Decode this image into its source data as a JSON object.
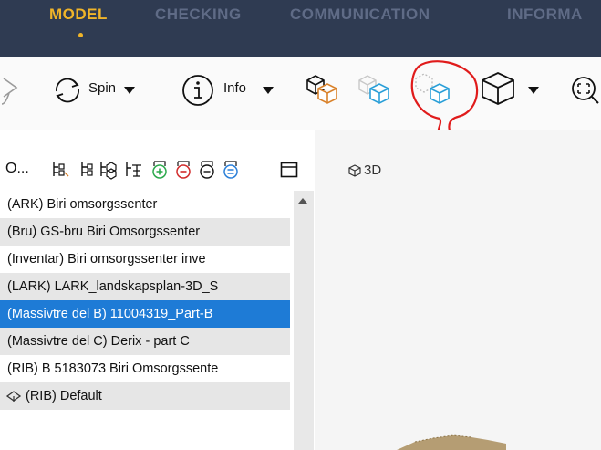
{
  "nav": {
    "tabs": [
      "MODEL",
      "CHECKING",
      "COMMUNICATION",
      "INFORMA"
    ],
    "active": "MODEL"
  },
  "toolbar": {
    "spin_label": "Spin",
    "info_label": "Info"
  },
  "panel": {
    "title": "O..."
  },
  "models": [
    {
      "label": "(ARK) Biri omsorgssenter"
    },
    {
      "label": "(Bru) GS-bru Biri Omsorgssenter"
    },
    {
      "label": "(Inventar) Biri omsorgssenter inve"
    },
    {
      "label": "(LARK) LARK_landskapsplan-3D_S"
    },
    {
      "label": "(Massivtre del B) 11004319_Part-B"
    },
    {
      "label": "(Massivtre del C) Derix - part C"
    },
    {
      "label": "(RIB) B 5183073 Biri Omsorgssente"
    },
    {
      "label": "(RIB) Default"
    }
  ],
  "selected_index": 4,
  "viewport": {
    "view_label": "3D"
  },
  "colors": {
    "nav_bg": "#2f3b52",
    "active_tab": "#f0b429",
    "selection": "#1e7bd6",
    "annotation": "#e01b1b",
    "cube_blue": "#2a9fd8",
    "cube_orange": "#d9822b"
  },
  "icons": [
    "undo-icon",
    "spin-icon",
    "info-icon",
    "cube-show-all-icon",
    "cube-ghost-icon",
    "cube-isolate-icon",
    "cube-view-icon",
    "zoom-extents-icon"
  ]
}
